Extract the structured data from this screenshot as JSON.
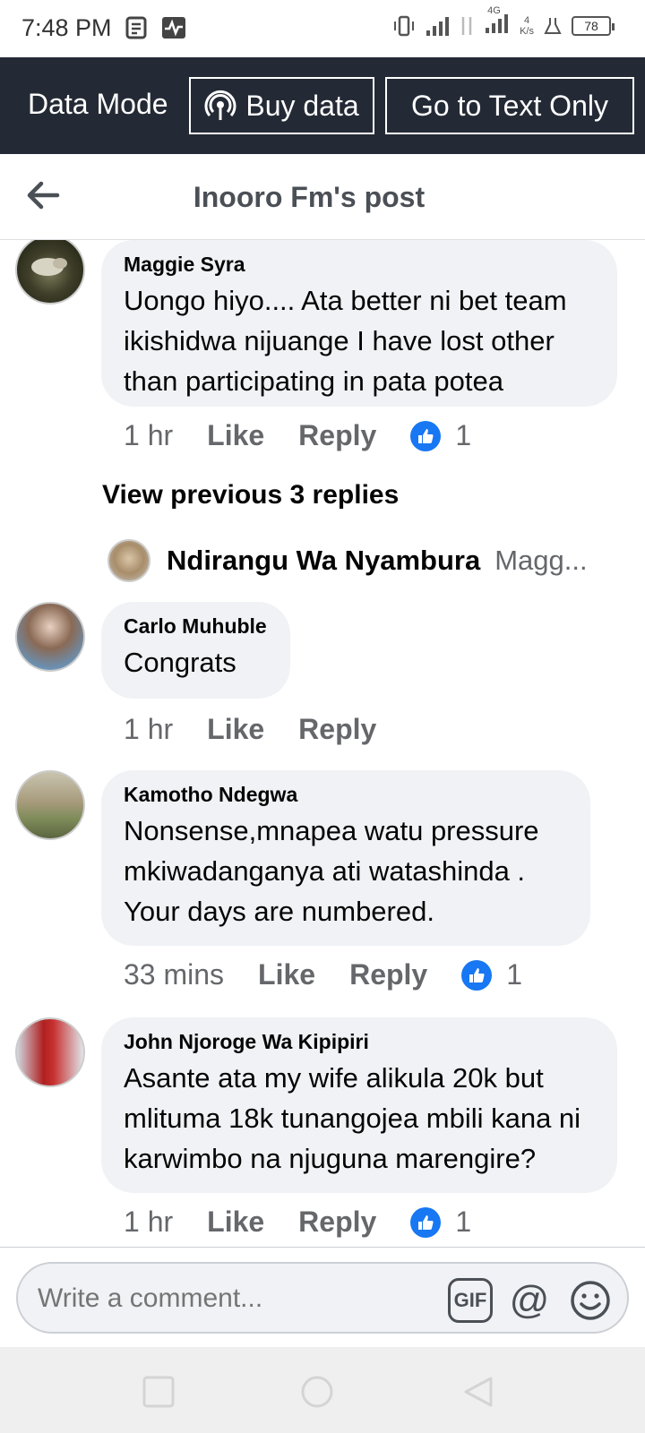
{
  "status": {
    "time": "7:48 PM",
    "battery": "78",
    "net_speed_value": "4",
    "net_speed_unit": "K/s",
    "network": "4G"
  },
  "data_bar": {
    "label": "Data Mode",
    "buy_label": "Buy data",
    "text_only_label": "Go to Text Only"
  },
  "header": {
    "title": "Inooro Fm's post"
  },
  "comments": [
    {
      "author": "Maggie Syra",
      "text": "Uongo hiyo.... Ata better ni bet team ikishidwa nijuange I have lost other than participating in pata potea",
      "time": "1 hr",
      "like_label": "Like",
      "reply_label": "Reply",
      "likes": "1"
    },
    {
      "author": "Carlo Muhuble",
      "text": "Congrats",
      "time": "1 hr",
      "like_label": "Like",
      "reply_label": "Reply"
    },
    {
      "author": "Kamotho Ndegwa",
      "text": "Nonsense,mnapea watu pressure mkiwadanganya ati watashinda . Your days are numbered.",
      "time": "33 mins",
      "like_label": "Like",
      "reply_label": "Reply",
      "likes": "1"
    },
    {
      "author": "John Njoroge Wa Kipipiri",
      "text": "Asante ata my wife alikula 20k but mlituma 18k tunangojea mbili kana ni karwimbo na njuguna marengire?",
      "time": "1 hr",
      "like_label": "Like",
      "reply_label": "Reply",
      "likes": "1"
    }
  ],
  "view_previous": "View previous 3 replies",
  "reply_preview": {
    "name": "Ndirangu Wa Nyambura",
    "snippet": "Magg..."
  },
  "composer": {
    "placeholder": "Write a comment...",
    "gif_label": "GIF",
    "at_label": "@"
  },
  "colors": {
    "data_bar_bg": "#242a35",
    "bubble_bg": "#f0f2f5",
    "like_blue": "#1877f2",
    "meta_gray": "#65676b"
  }
}
